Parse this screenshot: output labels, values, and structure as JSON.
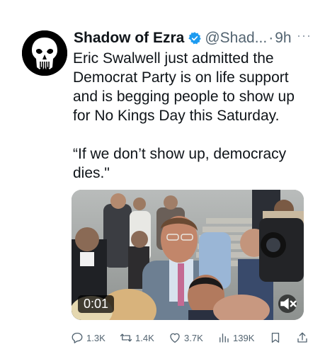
{
  "author": {
    "display_name": "Shadow of Ezra",
    "handle": "@Shad...",
    "separator": "·",
    "time": "9h",
    "more": "···"
  },
  "tweet": {
    "text": "Eric Swalwell just admitted the Democrat Party is on life support and is begging people to show up for No Kings Day this Saturday.",
    "quote": "“If we don’t show up, democracy dies.\""
  },
  "media": {
    "duration": "0:01"
  },
  "actions": {
    "replies": "1.3K",
    "reposts": "1.4K",
    "likes": "3.7K",
    "views": "139K"
  },
  "colors": {
    "verified": "#1d9bf0",
    "text": "#0f1419",
    "secondary": "#536471"
  }
}
